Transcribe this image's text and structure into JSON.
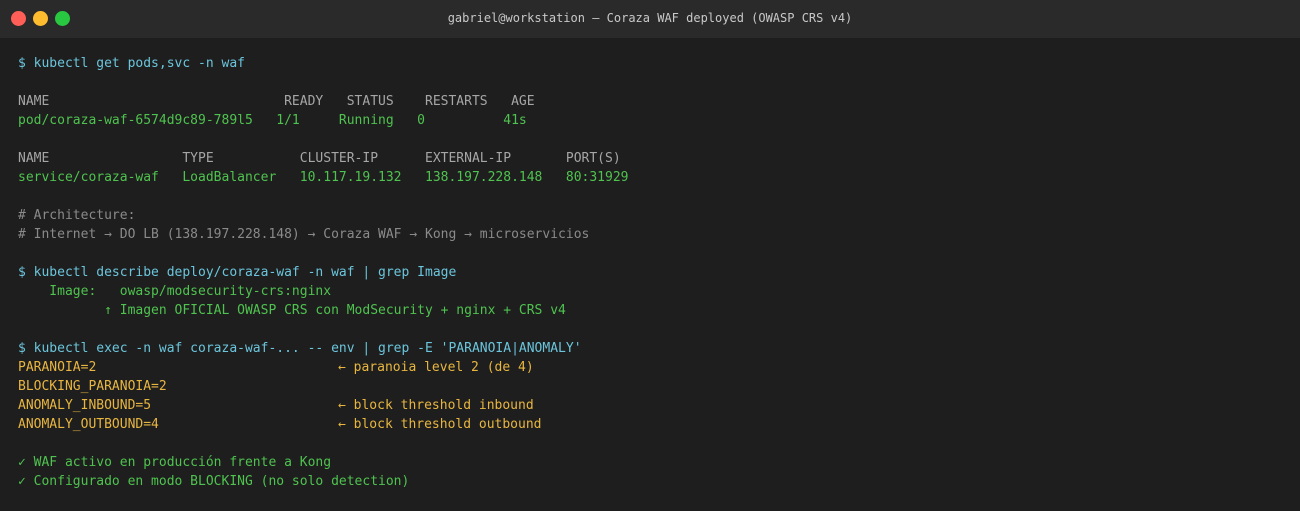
{
  "window": {
    "title": "gabriel@workstation — Coraza WAF deployed (OWASP CRS v4)"
  },
  "colors": {
    "prompt": "#6bc5dc",
    "success": "#4fc34f",
    "comment": "#8a8a8a",
    "highlight": "#e8b640",
    "header": "#a6a6a6"
  },
  "terminal": {
    "cmd1": "$ kubectl get pods,svc -n waf",
    "pods_header": "NAME                              READY   STATUS    RESTARTS   AGE",
    "pods_row": "pod/coraza-waf-6574d9c89-789l5   1/1     Running   0          41s",
    "svc_header": "NAME                 TYPE           CLUSTER-IP      EXTERNAL-IP       PORT(S)",
    "svc_row": "service/coraza-waf   LoadBalancer   10.117.19.132   138.197.228.148   80:31929",
    "arch_comment_1": "# Architecture:",
    "arch_comment_2": "# Internet → DO LB (138.197.228.148) → Coraza WAF → Kong → microservicios",
    "cmd2": "$ kubectl describe deploy/coraza-waf -n waf | grep Image",
    "image_line": "    Image:   owasp/modsecurity-crs:nginx",
    "image_note": "           ↑ Imagen OFICIAL OWASP CRS con ModSecurity + nginx + CRS v4",
    "cmd3": "$ kubectl exec -n waf coraza-waf-... -- env | grep -E 'PARANOIA|ANOMALY'",
    "env": [
      {
        "var": "PARANOIA=2",
        "note": "← paranoia level 2 (de 4)"
      },
      {
        "var": "BLOCKING_PARANOIA=2",
        "note": ""
      },
      {
        "var": "ANOMALY_INBOUND=5",
        "note": "← block threshold inbound"
      },
      {
        "var": "ANOMALY_OUTBOUND=4",
        "note": "← block threshold outbound"
      }
    ],
    "status_1": "✓ WAF activo en producción frente a Kong",
    "status_2": "✓ Configurado en modo BLOCKING (no solo detection)"
  }
}
